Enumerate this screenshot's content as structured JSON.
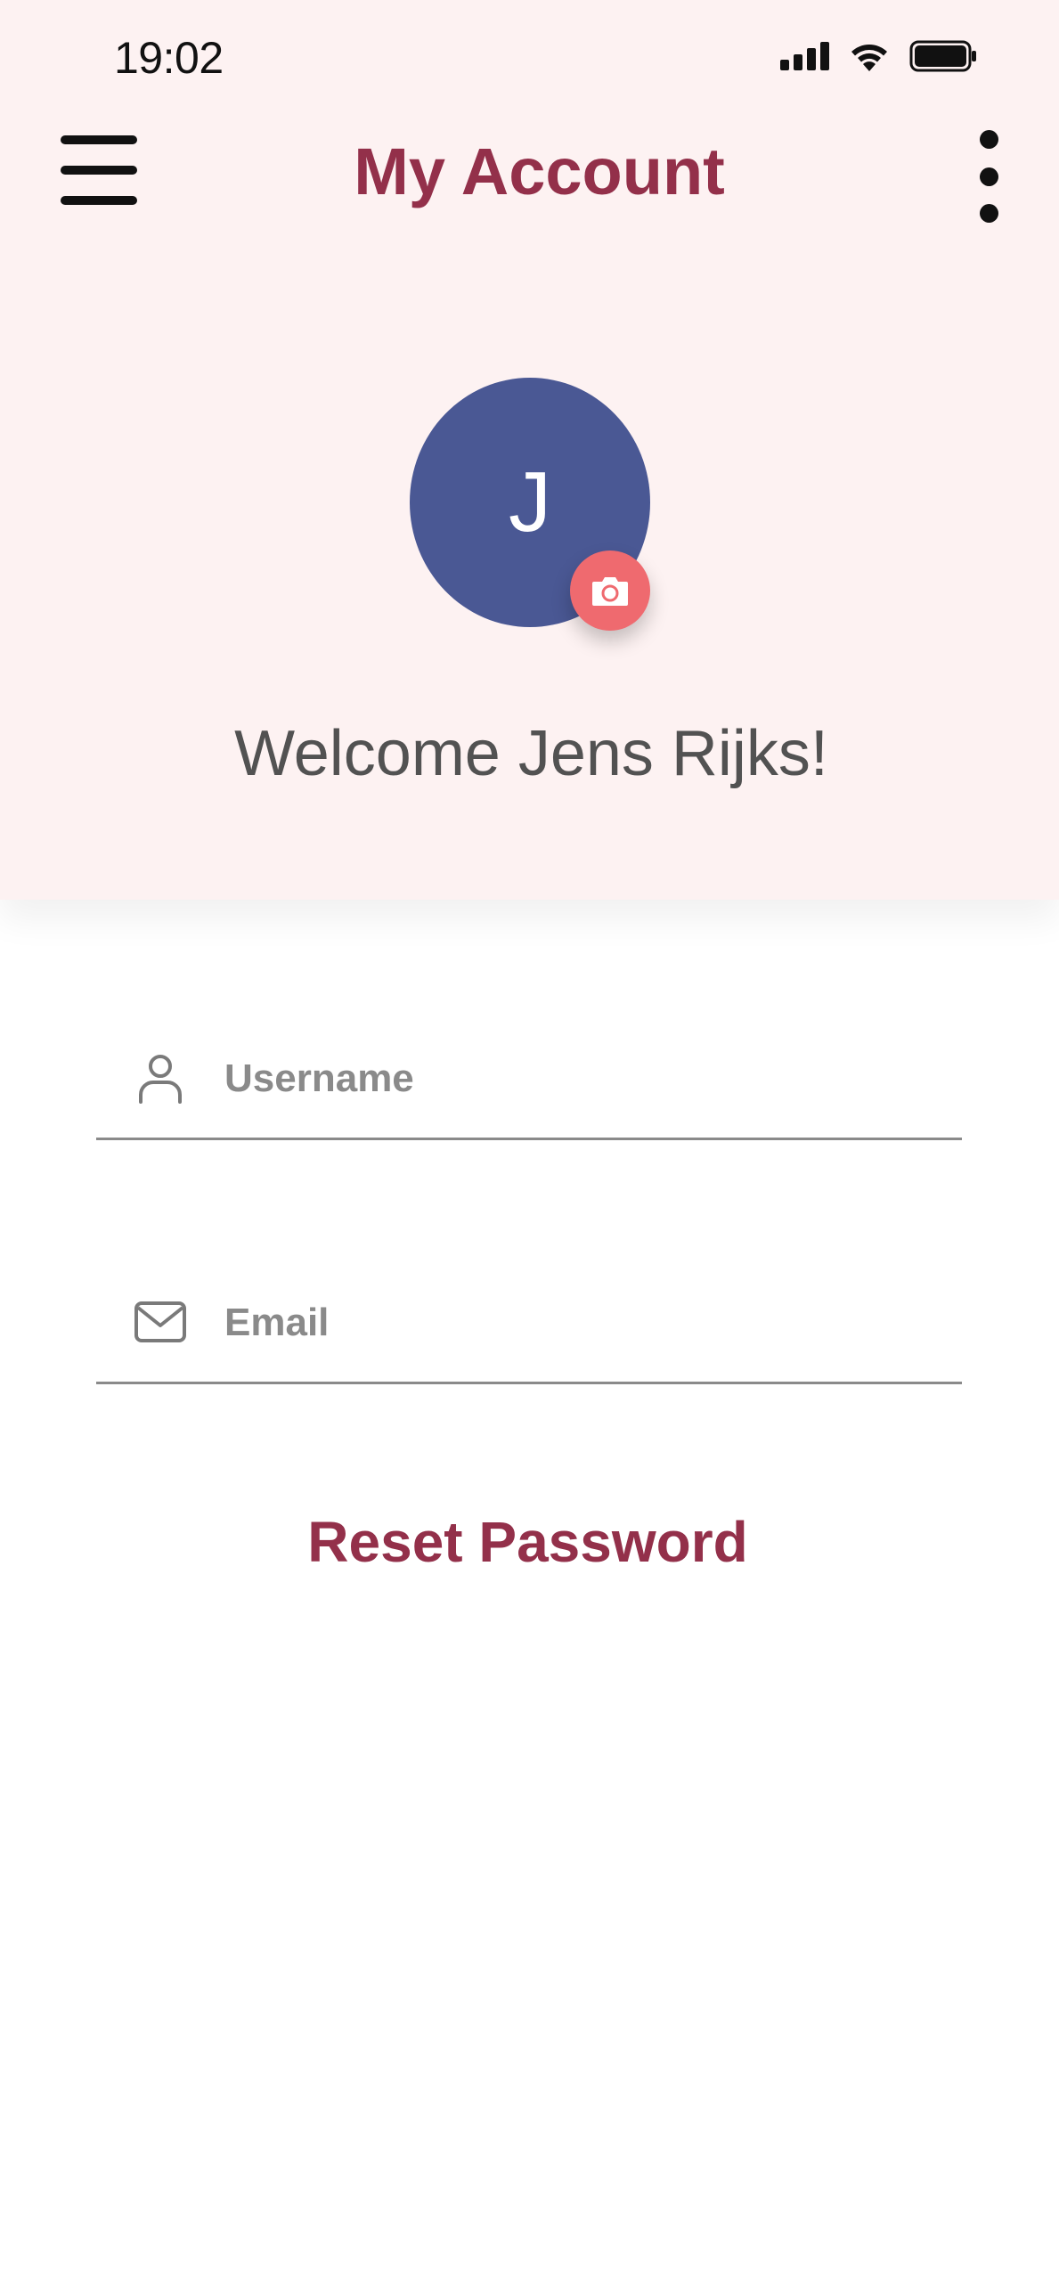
{
  "status_bar": {
    "time": "19:02",
    "signal_icon": "cellular-signal-icon",
    "wifi_icon": "wifi-icon",
    "battery_icon": "battery-icon"
  },
  "app_bar": {
    "title": "My Account",
    "menu_icon": "hamburger-menu-icon",
    "more_icon": "more-vertical-icon"
  },
  "profile": {
    "avatar_initial": "J",
    "camera_icon": "camera-icon",
    "welcome_text": "Welcome Jens Rijks!"
  },
  "form": {
    "username": {
      "icon": "user-icon",
      "placeholder": "Username",
      "value": ""
    },
    "email": {
      "icon": "mail-icon",
      "placeholder": "Email",
      "value": ""
    },
    "reset_password_label": "Reset Password"
  },
  "colors": {
    "header_bg": "#fdf2f2",
    "accent": "#93304a",
    "avatar_bg": "#4a5894",
    "camera_bg": "#ef6a6f",
    "welcome_text": "#525252",
    "placeholder": "#8a8a8a"
  }
}
